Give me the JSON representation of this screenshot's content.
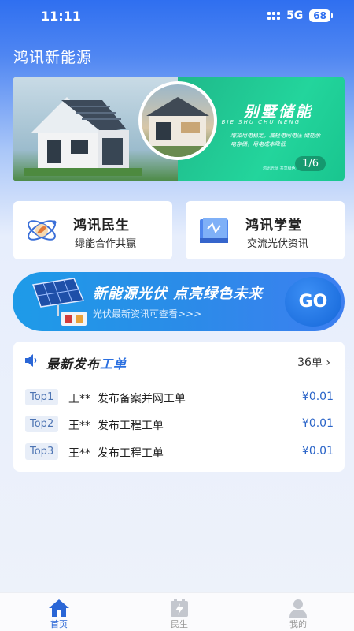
{
  "status": {
    "time": "11:11",
    "network": "5G",
    "battery": "68"
  },
  "app": {
    "title": "鸿讯新能源"
  },
  "banner": {
    "title": "别墅储能",
    "subtitle": "BIE SHU CHU NENG",
    "desc": "增加用电稳定，减轻电网电压 储能余电存储，用电成本降低",
    "footnote": "鸿讯光伏  共享绿色",
    "pager": "1/6"
  },
  "cards": [
    {
      "title": "鸿讯民生",
      "subtitle": "绿能合作共赢",
      "icon": "atom-leaf-icon"
    },
    {
      "title": "鸿讯学堂",
      "subtitle": "交流光伏资讯",
      "icon": "book-icon"
    }
  ],
  "promo": {
    "title": "新能源光伏 点亮绿色未来",
    "subtitle": "光伏最新资讯可查看>>>",
    "button": "GO"
  },
  "orders": {
    "title_prefix": "最新发布",
    "title_highlight": "工单",
    "count": "36单",
    "rows": [
      {
        "tag": "Top1",
        "name": "王**",
        "action": "发布备案并网工单",
        "price": "¥0.01"
      },
      {
        "tag": "Top2",
        "name": "王**",
        "action": "发布工程工单",
        "price": "¥0.01"
      },
      {
        "tag": "Top3",
        "name": "王**",
        "action": "发布工程工单",
        "price": "¥0.01"
      }
    ]
  },
  "tabs": [
    {
      "label": "首页",
      "icon": "home-icon",
      "active": true
    },
    {
      "label": "民生",
      "icon": "lightning-battery-icon",
      "active": false
    },
    {
      "label": "我的",
      "icon": "user-icon",
      "active": false
    }
  ],
  "colors": {
    "primary": "#2a66d6",
    "banner_green": "#23d59c",
    "promo_blue": "#1e9be8"
  }
}
